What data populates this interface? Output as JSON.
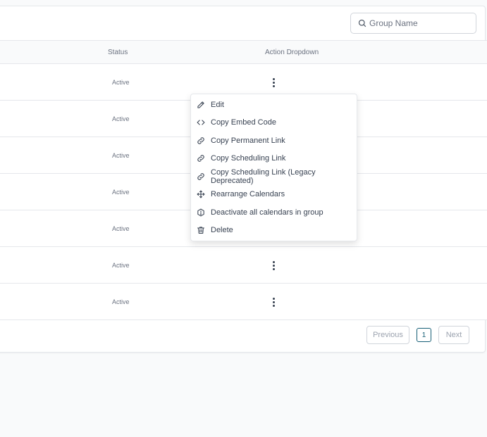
{
  "search": {
    "placeholder": "Group Name"
  },
  "table": {
    "headers": {
      "status": "Status",
      "action": "Action Dropdown"
    },
    "rows": [
      {
        "status": "Active"
      },
      {
        "status": "Active"
      },
      {
        "status": "Active"
      },
      {
        "status": "Active"
      },
      {
        "status": "Active"
      },
      {
        "status": "Active"
      },
      {
        "status": "Active"
      }
    ]
  },
  "dropdown": {
    "items": [
      {
        "label": "Edit",
        "icon": "pencil-icon"
      },
      {
        "label": "Copy Embed Code",
        "icon": "code-icon"
      },
      {
        "label": "Copy Permanent Link",
        "icon": "link-icon"
      },
      {
        "label": "Copy Scheduling Link",
        "icon": "link-icon"
      },
      {
        "label": "Copy Scheduling Link (Legacy Deprecated)",
        "icon": "link-icon"
      },
      {
        "label": "Rearrange Calendars",
        "icon": "move-icon"
      },
      {
        "label": "Deactivate all calendars in group",
        "icon": "hexagon-icon"
      },
      {
        "label": "Delete",
        "icon": "trash-icon"
      }
    ]
  },
  "pagination": {
    "previous": "Previous",
    "current": "1",
    "next": "Next"
  }
}
